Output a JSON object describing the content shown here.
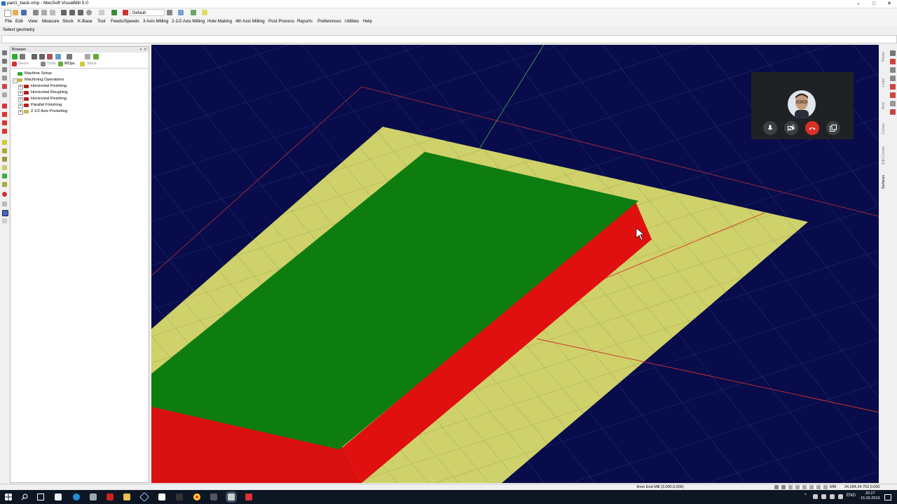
{
  "window": {
    "title": "part1_back.vmp - MecSoft VisualMill 5.0"
  },
  "toolbar": {
    "profile": "Default"
  },
  "menu": [
    "File",
    "Edit",
    "View",
    "Measure",
    "Stock",
    "K-Base",
    "Tool",
    "Feeds/Speeds",
    "3 Axis Milling",
    "2-1/2 Axis Milling",
    "Hole Making",
    "4th Axis Milling",
    "Post Process",
    "Reports",
    "Preferences",
    "Utilities",
    "Help"
  ],
  "hint": "Select geometry",
  "browser": {
    "title": "Browser",
    "tabs": [
      "Geom",
      "Tools",
      "MOps",
      "Stock"
    ],
    "active_tab": "MOps",
    "tree": [
      {
        "label": "Machine Setup",
        "level": 0
      },
      {
        "label": "Machining Operations",
        "level": 0
      },
      {
        "label": "Horizontal Finishing",
        "level": 1
      },
      {
        "label": "Horizontal Roughing",
        "level": 1
      },
      {
        "label": "Horizontal Finishing",
        "level": 1
      },
      {
        "label": "Parallel Finishing",
        "level": 1
      },
      {
        "label": "2 1/2 Axis Pocketing",
        "level": 1
      }
    ]
  },
  "right_tabs": [
    "Points",
    "Lines",
    "Arcs",
    "Curves",
    "Edit Curves",
    "Surfaces"
  ],
  "status": {
    "tool": "3mm End Mill (3.000,0.000)",
    "coords": "24.284,24.752,0.000"
  },
  "taskbar": {
    "lang": "ENG",
    "time": "20:27",
    "date": "15.09.2019"
  },
  "colors": {
    "viewport_bg": "#080c4a",
    "stock": "#cfd16a",
    "part_top": "#0e7d10",
    "part_wall": "#e01010",
    "grid_red": "#d23030",
    "call_red": "#d93025"
  }
}
